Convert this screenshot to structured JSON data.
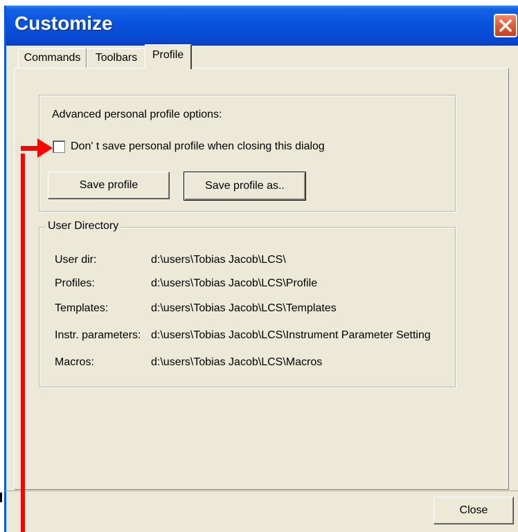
{
  "window": {
    "title": "Customize"
  },
  "tabs": [
    {
      "label": "Commands",
      "active": false
    },
    {
      "label": "Toolbars",
      "active": false
    },
    {
      "label": "Profile",
      "active": true
    }
  ],
  "profile": {
    "advanced_heading": "Advanced personal profile options:",
    "dont_save_checkbox": {
      "label": "Don' t save personal profile when closing this dialog",
      "checked": false
    },
    "save_profile_label": "Save profile",
    "save_profile_as_label": "Save profile as.."
  },
  "user_directory": {
    "legend": "User Directory",
    "rows": [
      {
        "label": "User dir:",
        "value": "d:\\users\\Tobias Jacob\\LCS\\"
      },
      {
        "label": "Profiles:",
        "value": "d:\\users\\Tobias Jacob\\LCS\\Profile"
      },
      {
        "label": "Templates:",
        "value": "d:\\users\\Tobias Jacob\\LCS\\Templates"
      },
      {
        "label": "Instr. parameters:",
        "value": "d:\\users\\Tobias Jacob\\LCS\\Instrument Parameter Setting"
      },
      {
        "label": "Macros:",
        "value": "d:\\users\\Tobias Jacob\\LCS\\Macros"
      }
    ]
  },
  "footer": {
    "close_label": "Close"
  },
  "icons": {
    "title_close": "close-icon",
    "annotation": "red-arrow-icon"
  },
  "colors": {
    "titlebar": "#0a55de",
    "close_button": "#e25a34",
    "dialog_face": "#ece9d8",
    "annotation": "#ff0000"
  }
}
